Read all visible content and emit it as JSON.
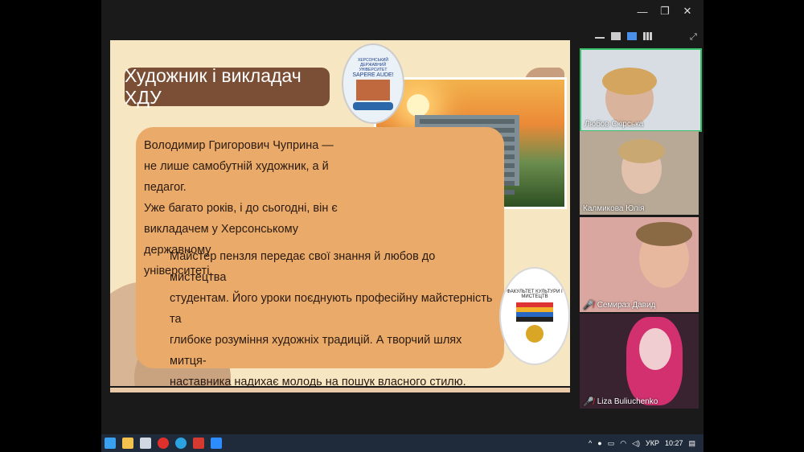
{
  "slide": {
    "title": "Художник і викладач ХДУ",
    "logo_motto": "SAPERE AUDE!",
    "logo_arc": "ХЕРСОНСЬКИЙ ДЕРЖАВНИЙ УНІВЕРСИТЕТ",
    "paragraph1_lines": [
      "Володимир Григорович Чуприна —",
      "не лише самобутній художник, а й педагог.",
      "Уже багато років, і до сьогодні, він є",
      "викладачем у Херсонському державному",
      "університеті."
    ],
    "paragraph2_lines": [
      "Майстер пензля передає свої знання й любов до мистецтва",
      "студентам. Його уроки поєднують професійну майстерність та",
      "глибоке розуміння художніх традицій. А творчий шлях митця-",
      "наставника надихає молодь на пошук власного стилю."
    ],
    "badge_text": "ФАКУЛЬТЕТ КУЛЬТУРИ І МИСТЕЦТВ"
  },
  "participants": [
    {
      "name": "Любов Скірська",
      "muted": false
    },
    {
      "name": "Калмикова Юлія",
      "muted": false
    },
    {
      "name": "Семираз Давид",
      "muted": true
    },
    {
      "name": "Liza Buliuchenko",
      "muted": true
    }
  ],
  "taskbar": {
    "language": "УКР",
    "time": "10:27"
  }
}
